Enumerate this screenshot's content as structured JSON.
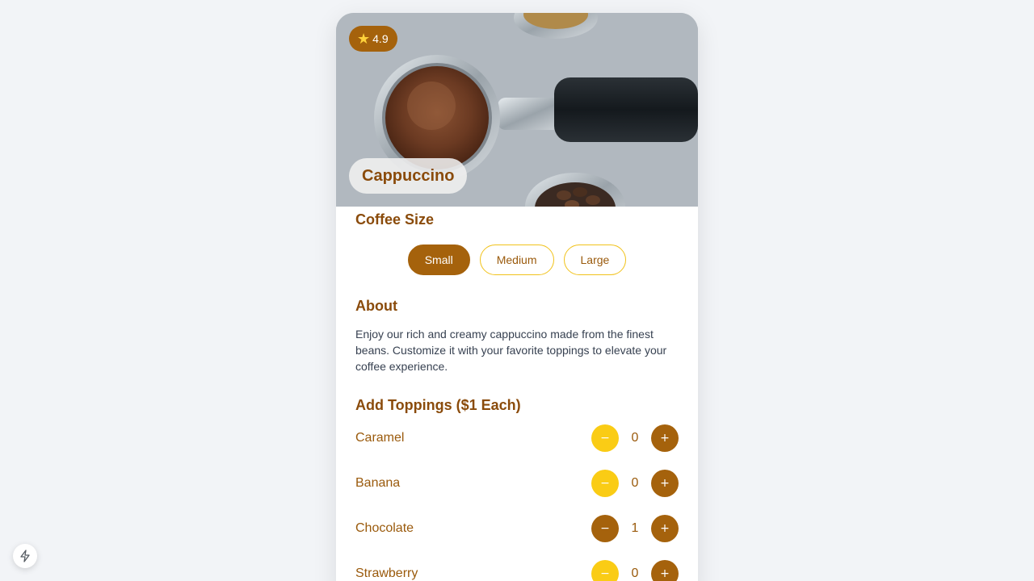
{
  "product": {
    "name": "Cappuccino",
    "rating": "4.9",
    "image_icon": "coffee-portafilter-photo"
  },
  "size_section": {
    "heading": "Coffee Size",
    "options": [
      "Small",
      "Medium",
      "Large"
    ],
    "selected": "Small"
  },
  "about": {
    "heading": "About",
    "text": "Enjoy our rich and creamy cappuccino made from the finest beans. Customize it with your favorite toppings to elevate your coffee experience."
  },
  "toppings": {
    "heading": "Add Toppings ($1 Each)",
    "items": [
      {
        "name": "Caramel",
        "qty": "0"
      },
      {
        "name": "Banana",
        "qty": "0"
      },
      {
        "name": "Chocolate",
        "qty": "1"
      },
      {
        "name": "Strawberry",
        "qty": "0"
      }
    ],
    "minus_label": "−",
    "plus_label": "+"
  },
  "colors": {
    "brand": "#a5620c",
    "accent": "#facc15",
    "heading": "#8a4b0b"
  },
  "corner_icon": "bolt-icon"
}
